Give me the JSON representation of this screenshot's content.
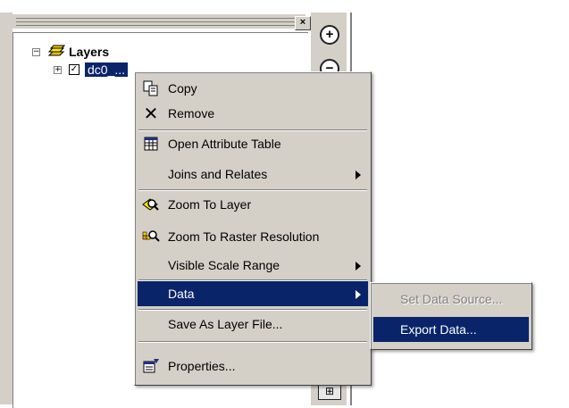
{
  "toc": {
    "close_label": "×",
    "root_label": "Layers",
    "layer_label": "dc0_..."
  },
  "context_menu": {
    "items": [
      {
        "label": "Copy",
        "icon": "copy-icon"
      },
      {
        "label": "Remove",
        "icon": "remove-x-icon"
      },
      {
        "label": "Open Attribute Table",
        "icon": "table-icon"
      },
      {
        "label": "Joins and Relates",
        "submenu": true
      },
      {
        "label": "Zoom To Layer",
        "icon": "zoom-to-layer-icon"
      },
      {
        "label": "Zoom To Raster Resolution",
        "icon": "zoom-raster-icon"
      },
      {
        "label": "Visible Scale Range",
        "submenu": true
      },
      {
        "label": "Data",
        "submenu": true,
        "highlighted": true
      },
      {
        "label": "Save As Layer File..."
      },
      {
        "label": "Properties...",
        "icon": "properties-icon"
      }
    ]
  },
  "data_submenu": {
    "items": [
      {
        "label": "Set Data Source...",
        "disabled": true
      },
      {
        "label": "Export Data...",
        "highlighted": true
      }
    ]
  },
  "tools": {
    "zoom_in": "+",
    "zoom_out": "−"
  },
  "colors": {
    "highlight": "#0a246a",
    "menu_bg": "#d4d0c8"
  }
}
